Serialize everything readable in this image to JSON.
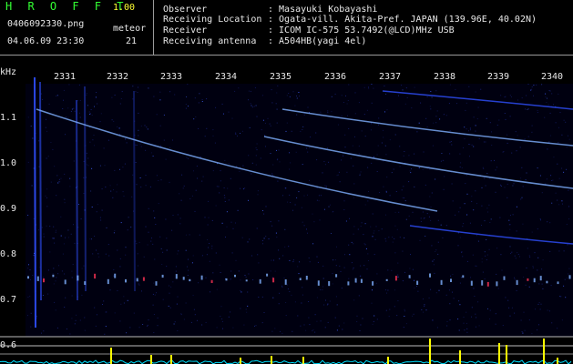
{
  "header": {
    "app_title": "H R O F F T",
    "app_version": "1.00",
    "file_name": "0406092330.png",
    "meteor_label": "meteor",
    "timestamp": "04.06.09 23:30",
    "meteor_count": "21"
  },
  "info": [
    {
      "label": "Observer",
      "value": ": Masayuki Kobayashi"
    },
    {
      "label": "Receiving Location",
      "value": ": Ogata-vill. Akita-Pref. JAPAN (139.96E, 40.02N)"
    },
    {
      "label": "Receiver",
      "value": ": ICOM IC-575 53.7492(@LCD)MHz USB"
    },
    {
      "label": "Receiving antenna",
      "value": ": A504HB(yagi 4el)"
    }
  ],
  "spectrogram": {
    "y_unit": "kHz",
    "y_ticks": [
      "1.1",
      "1.0",
      "0.9",
      "0.8",
      "0.7",
      "0.6"
    ],
    "x_ticks": [
      "2331",
      "2332",
      "2333",
      "2334",
      "2335",
      "2336",
      "2337",
      "2338",
      "2339",
      "2340"
    ],
    "colors": {
      "background": "#000010",
      "signal": "#3050ff",
      "strong": "#80b0ff",
      "grid": "#bbbbbb",
      "peak": "#ffff00",
      "trace": "#00e0ff"
    }
  }
}
